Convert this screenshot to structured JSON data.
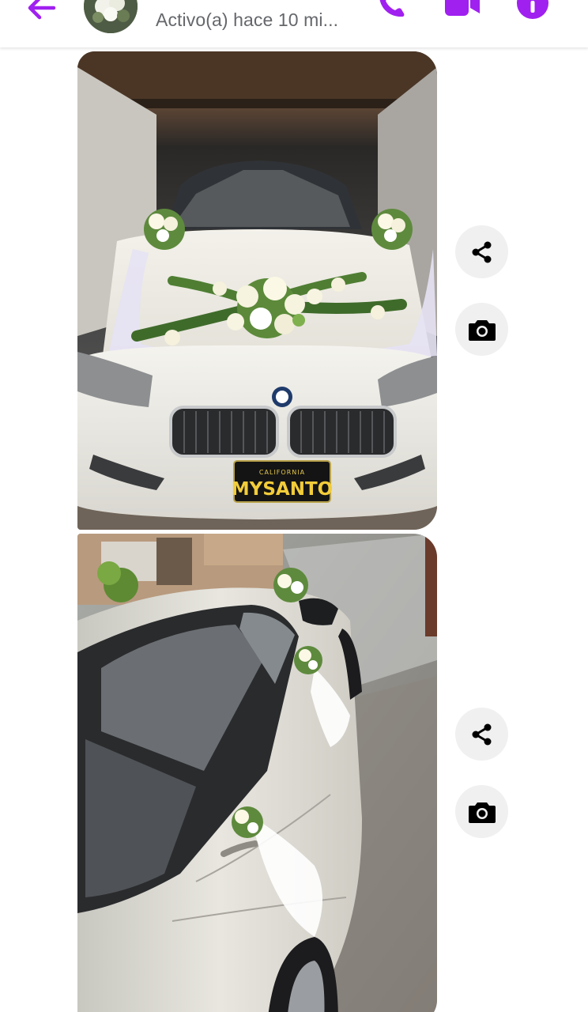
{
  "header": {
    "status": "Activo(a) hace 10 mi...",
    "accent_color": "#a020f0",
    "icons": [
      "back-arrow-icon",
      "avatar",
      "phone-icon",
      "video-camera-icon",
      "info-icon"
    ]
  },
  "messages": [
    {
      "type": "photo",
      "subject": "white car front decorated with flowers",
      "plate_state": "CALIFORNIA",
      "plate_text": "MYSANTO",
      "actions": [
        "share-icon",
        "camera-icon"
      ]
    },
    {
      "type": "photo",
      "subject": "white car side decorated with flowers and tulle",
      "actions": [
        "share-icon",
        "camera-icon"
      ]
    }
  ]
}
